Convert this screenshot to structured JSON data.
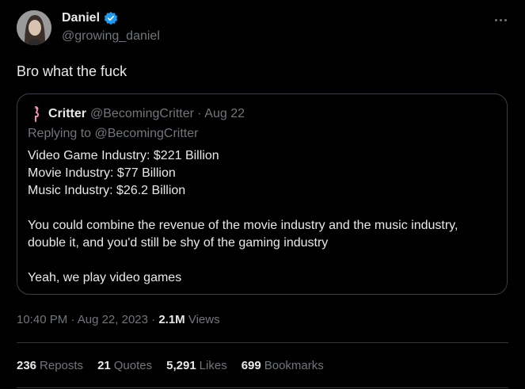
{
  "author": {
    "name": "Daniel",
    "handle": "@growing_daniel",
    "verified": true,
    "verified_color": "#1d9bf0"
  },
  "tweet": {
    "text": "Bro what the fuck"
  },
  "quoted": {
    "name": "Critter",
    "handle": "@BecomingCritter",
    "separator": "·",
    "date": "Aug 22",
    "replying_to": "Replying to @BecomingCritter",
    "lines": [
      "Video Game Industry: $221 Billion",
      "Movie Industry: $77 Billion",
      "Music Industry: $26.2 Billion"
    ],
    "paragraph": "You could combine the revenue of the movie industry and the music industry, double it, and you'd still be shy of the gaming industry",
    "closing": "Yeah, we play video games"
  },
  "meta": {
    "time": "10:40 PM",
    "sep1": " · ",
    "date": "Aug 22, 2023",
    "sep2": " · ",
    "views_count": "2.1M",
    "views_label": "Views"
  },
  "stats": [
    {
      "num": "236",
      "label": "Reposts"
    },
    {
      "num": "21",
      "label": "Quotes"
    },
    {
      "num": "5,291",
      "label": "Likes"
    },
    {
      "num": "699",
      "label": "Bookmarks"
    }
  ],
  "icons": {
    "avatar": "profile-photo",
    "verified": "verified-badge-icon",
    "more": "more-options-icon",
    "quoted_avatar": "flamingo-avatar"
  }
}
